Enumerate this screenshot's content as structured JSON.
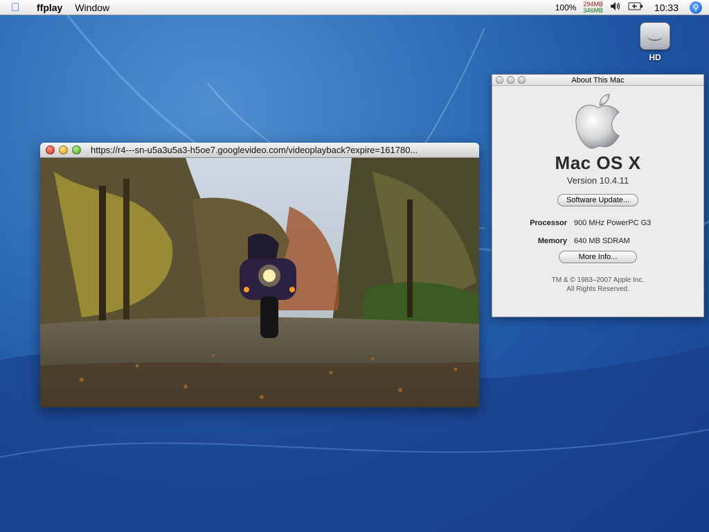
{
  "menubar": {
    "app_name": "ffplay",
    "menus": [
      "Window"
    ],
    "zoom": "100%",
    "mem_used": "294MB",
    "mem_free": "346MB",
    "clock": "10:33"
  },
  "desktop": {
    "hd_label": "HD"
  },
  "video_window": {
    "title": "https://r4---sn-u5a3u5a3-h5oe7.googlevideo.com/videoplayback?expire=161780..."
  },
  "about": {
    "title": "About This Mac",
    "os_name": "Mac OS X",
    "version": "Version 10.4.11",
    "software_update": "Software Update...",
    "processor_label": "Processor",
    "processor_value": "900 MHz PowerPC G3",
    "memory_label": "Memory",
    "memory_value": "640 MB SDRAM",
    "more_info": "More Info...",
    "copyright_line1": "TM & © 1983–2007 Apple Inc.",
    "copyright_line2": "All Rights Reserved."
  },
  "icons": [
    "apple-menu-icon",
    "volume-icon",
    "battery-icon",
    "spotlight-icon",
    "hard-drive-icon"
  ],
  "colors": {
    "accent": "#2a6fe0",
    "desktop": "#2f6fb8"
  }
}
